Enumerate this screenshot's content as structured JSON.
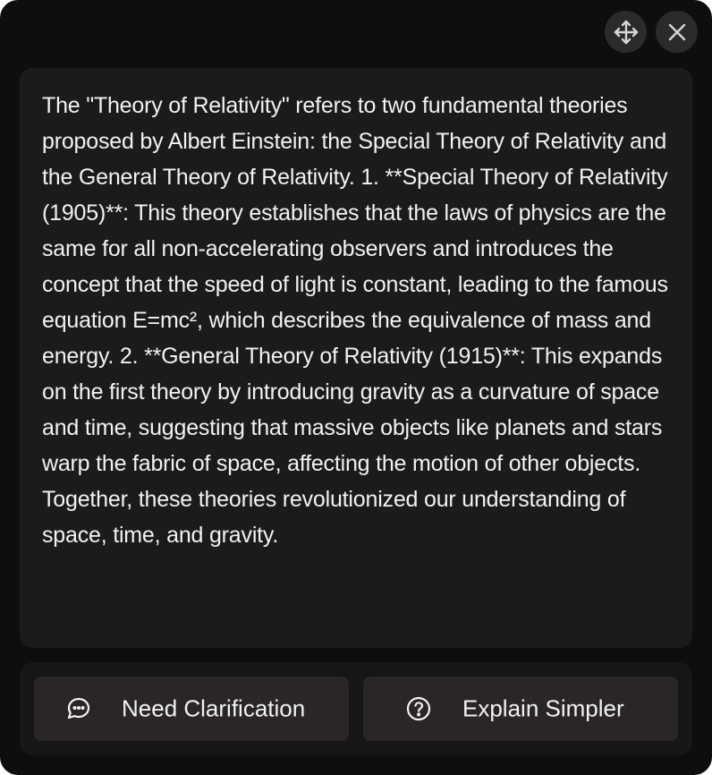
{
  "controls": {
    "move_icon": "move-icon",
    "close_icon": "close-icon"
  },
  "response": {
    "text": "The \"Theory of Relativity\" refers to two fundamental theories proposed by Albert Einstein: the Special Theory of Relativity and the General Theory of Relativity. 1. **Special Theory of Relativity (1905)**: This theory establishes that the laws of physics are the same for all non-accelerating observers and introduces the concept that the speed of light is constant, leading to the famous equation E=mc², which describes the equivalence of mass and energy. 2. **General Theory of Relativity (1915)**: This expands on the first theory by introducing gravity as a curvature of space and time, suggesting that massive objects like planets and stars warp the fabric of space, affecting the motion of other objects. Together, these theories revolutionized our understanding of space, time, and gravity."
  },
  "actions": {
    "clarify_label": "Need Clarification",
    "clarify_icon": "chat-bubble-icon",
    "simpler_label": "Explain Simpler",
    "simpler_icon": "question-circle-icon"
  },
  "colors": {
    "window_bg": "#0e0e0e",
    "card_bg": "#1b1b1c",
    "button_bg": "#2a2626",
    "text": "#f2f2f2"
  }
}
